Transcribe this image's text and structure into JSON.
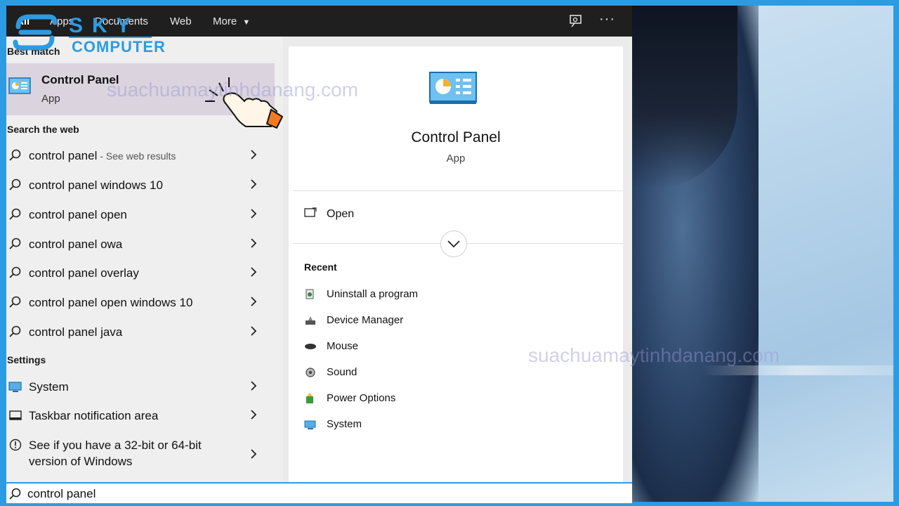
{
  "topbar": {
    "tabs": [
      "All",
      "Apps",
      "Documents",
      "Web",
      "More"
    ],
    "more_arrow": "▼",
    "more_options": "···"
  },
  "logo": {
    "brand": "SKY",
    "sub": "COMPUTER"
  },
  "watermark": {
    "text1": "suachuamaytinhdanang.com",
    "text2": "suachuamaytinhdanang.com"
  },
  "left": {
    "best_match_title": "Best match",
    "best_match": {
      "title": "Control Panel",
      "subtitle": "App"
    },
    "search_web_title": "Search the web",
    "web_results": [
      {
        "text": "control panel",
        "muted": " - See web results"
      },
      {
        "text": "control panel windows 10",
        "muted": ""
      },
      {
        "text": "control panel open",
        "muted": ""
      },
      {
        "text": "control panel owa",
        "muted": ""
      },
      {
        "text": "control panel overlay",
        "muted": ""
      },
      {
        "text": "control panel open windows 10",
        "muted": ""
      },
      {
        "text": "control panel java",
        "muted": ""
      }
    ],
    "settings_title": "Settings",
    "settings": [
      {
        "text": "System"
      },
      {
        "text": "Taskbar notification area"
      },
      {
        "line1": "See if you have a 32-bit or 64-bit",
        "line2": "version of Windows"
      }
    ]
  },
  "right": {
    "title": "Control Panel",
    "subtitle": "App",
    "open_label": "Open",
    "recent_title": "Recent",
    "recent": [
      "Uninstall a program",
      "Device Manager",
      "Mouse",
      "Sound",
      "Power Options",
      "System"
    ]
  },
  "search": {
    "value": "control panel"
  },
  "colors": {
    "accent": "#2d9be2",
    "topbar": "#1f1f1f",
    "selected_row": "#dbd3de"
  }
}
